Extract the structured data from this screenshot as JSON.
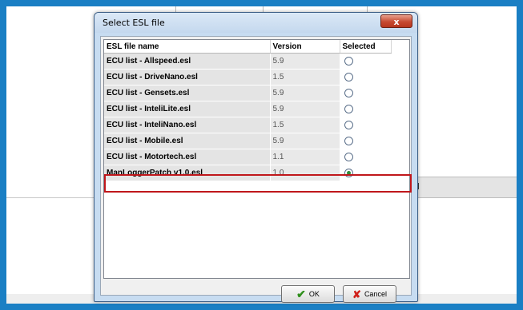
{
  "dialog": {
    "title": "Select ESL file",
    "close_label": "x"
  },
  "background": {
    "strip_text": "d"
  },
  "table": {
    "headers": [
      "ESL file name",
      "Version",
      "Selected"
    ],
    "rows": [
      {
        "name": "ECU list - Allspeed.esl",
        "version": "5.9",
        "selected": false
      },
      {
        "name": "ECU list - DriveNano.esl",
        "version": "1.5",
        "selected": false
      },
      {
        "name": "ECU list - Gensets.esl",
        "version": "5.9",
        "selected": false
      },
      {
        "name": "ECU list - InteliLite.esl",
        "version": "5.9",
        "selected": false
      },
      {
        "name": "ECU list - InteliNano.esl",
        "version": "1.5",
        "selected": false
      },
      {
        "name": "ECU list - Mobile.esl",
        "version": "5.9",
        "selected": false
      },
      {
        "name": "ECU list - Motortech.esl",
        "version": "1.1",
        "selected": false
      },
      {
        "name": "ManLoggerPatch v1.0.esl",
        "version": "1.0",
        "selected": true
      }
    ]
  },
  "buttons": {
    "ok_label": "OK",
    "cancel_label": "Cancel"
  },
  "icons": {
    "ok": "check-icon",
    "cancel": "x-icon",
    "close": "close-icon"
  },
  "colors": {
    "highlight": "#c0171b",
    "frame": "#1a7fc4",
    "radio_checked": "#2e8b3a"
  }
}
